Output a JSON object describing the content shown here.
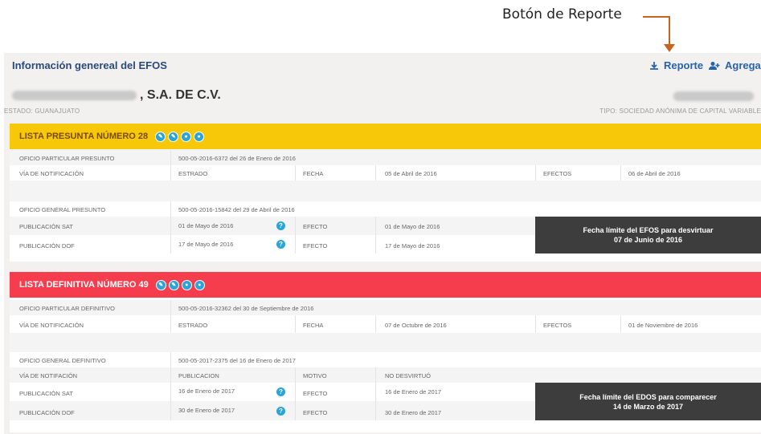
{
  "annotation": {
    "label": "Botón de Reporte"
  },
  "header": {
    "title": "Información genereal del EFOS",
    "report_label": "Reporte",
    "add_label": "Agregar"
  },
  "company": {
    "suffix": ", S.A. DE C.V.",
    "estado": "ESTADO: GUANAJUATO",
    "tipo": "TIPO: SOCIEDAD ANÓNIMA DE CAPITAL VARIABLE"
  },
  "presunta": {
    "title": "LISTA PRESUNTA NÚMERO 28",
    "color": "#f7c70a",
    "oficio_particular_label": "OFICIO PARTICULAR PRESUNTO",
    "oficio_particular_value": "500-05-2016-6372 del 26 de Enero de 2016",
    "via_label": "VÍA DE NOTIFICACIÓN",
    "via_value": "ESTRADO",
    "fecha_label": "FECHA",
    "fecha_value": "05 de Abril de 2016",
    "efectos_label": "EFECTOS",
    "efectos_value": "06 de Abril de 2016",
    "oficio_general_label": "OFICIO GENERAL PRESUNTO",
    "oficio_general_value": "500-05-2016-15842 del 29 de Abril de 2016",
    "pub_sat_label": "PUBLICACIÓN SAT",
    "pub_sat_value": "01 de Mayo de 2016",
    "efecto_sat_label": "EFECTO",
    "efecto_sat_value": "01 de Mayo de 2016",
    "pub_dof_label": "PUBLICACIÓN DOF",
    "pub_dof_value": "17 de Mayo de 2016",
    "efecto_dof_label": "EFECTO",
    "efecto_dof_value": "17 de Mayo de 2016",
    "deadline_line1": "Fecha límite del EFOS para desvirtuar",
    "deadline_line2": "07 de Junio de 2016"
  },
  "definitiva": {
    "title": "LISTA DEFINITIVA NÚMERO 49",
    "color": "#f53d4e",
    "oficio_particular_label": "OFICIO PARTICULAR DEFINITIVO",
    "oficio_particular_value": "500-05-2016-32362 del 30 de Septiembre de 2016",
    "via_label": "VÍA DE NOTIFICACIÓN",
    "via_value": "ESTRADO",
    "fecha_label": "FECHA",
    "fecha_value": "07 de Octubre de 2016",
    "efectos_label": "EFECTOS",
    "efectos_value": "01 de Noviembre de 2016",
    "oficio_general_label": "OFICIO GENERAL DEFINITIVO",
    "oficio_general_value": "500-05-2017-2375 del 16 de Enero de 2017",
    "via2_label": "VÍA DE NOTIFACIÓN",
    "via2_value": "PUBLICACION",
    "motivo_label": "MOTIVO",
    "motivo_value": "NO DESVIRTUÓ",
    "pub_sat_label": "PUBLICACIÓN SAT",
    "pub_sat_value": "16 de Enero de 2017",
    "efecto_sat_label": "EFECTO",
    "efecto_sat_value": "16 de Enero de 2017",
    "pub_dof_label": "PUBLICACIÓN DOF",
    "pub_dof_value": "30 de Enero de 2017",
    "efecto_dof_label": "EFECTO",
    "efecto_dof_value": "30 de Enero de 2017",
    "deadline_line1": "Fecha límite del EDOS para comparecer",
    "deadline_line2": "14 de Marzo de 2017"
  },
  "icons": {
    "header_icons": [
      "edit-icon",
      "edit-icon",
      "view-icon",
      "view-icon"
    ],
    "info": "?"
  }
}
